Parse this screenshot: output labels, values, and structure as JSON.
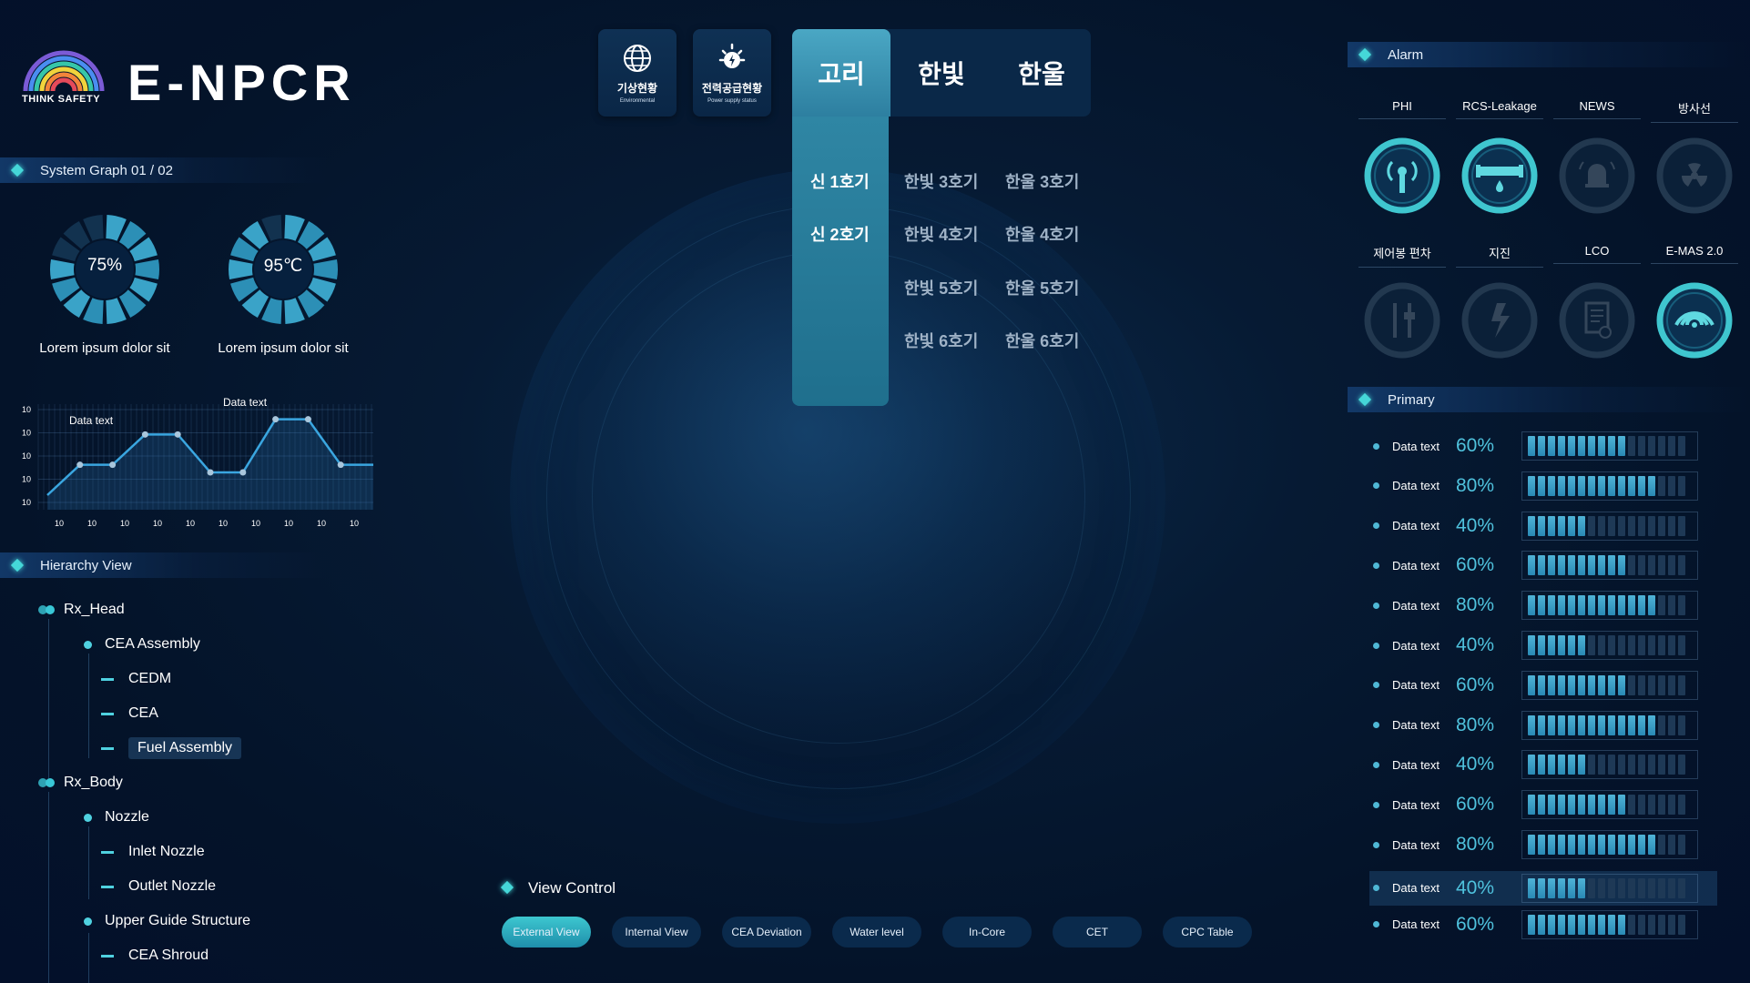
{
  "logo": {
    "title": "E-NPCR",
    "tagline": "THINK SAFETY"
  },
  "system_graph": {
    "title": "System Graph 01 / 02",
    "donuts": [
      {
        "value": "75%",
        "label": "Lorem ipsum dolor sit",
        "fraction": 0.75
      },
      {
        "value": "95℃",
        "label": "Lorem ipsum dolor sit",
        "fraction": 0.95
      }
    ]
  },
  "chart_data": {
    "type": "line",
    "annotations": [
      "Data text",
      "Data text"
    ],
    "ytick_labels": [
      "10",
      "10",
      "10",
      "10",
      "10"
    ],
    "xtick_labels": [
      "10",
      "10",
      "10",
      "10",
      "10",
      "10",
      "10",
      "10",
      "10",
      "10"
    ],
    "series": [
      {
        "values": [
          0,
          2,
          2,
          4,
          4,
          1.5,
          1.5,
          5,
          5,
          2,
          2
        ]
      }
    ],
    "ylim": [
      0,
      6
    ],
    "grid": true
  },
  "hierarchy": {
    "title": "Hierarchy View",
    "items": [
      {
        "label": "Rx_Head",
        "level": 0
      },
      {
        "label": "CEA Assembly",
        "level": 1
      },
      {
        "label": "CEDM",
        "level": 2
      },
      {
        "label": "CEA",
        "level": 2
      },
      {
        "label": "Fuel Assembly",
        "level": 2,
        "selected": true
      },
      {
        "label": "Rx_Body",
        "level": 0
      },
      {
        "label": "Nozzle",
        "level": 1
      },
      {
        "label": "Inlet Nozzle",
        "level": 2
      },
      {
        "label": "Outlet Nozzle",
        "level": 2
      },
      {
        "label": "Upper Guide Structure",
        "level": 1
      },
      {
        "label": "CEA Shroud",
        "level": 2
      }
    ]
  },
  "top_nav": {
    "weather": {
      "label": "기상현황",
      "sub": "Environmental",
      "icon": "globe-icon"
    },
    "power": {
      "label": "전력공급현황",
      "sub": "Power supply status",
      "icon": "power-icon"
    }
  },
  "sites": {
    "tabs": [
      "고리",
      "한빛",
      "한울"
    ],
    "active": "고리",
    "units": {
      "col1": [
        "신 1호기",
        "신 2호기"
      ],
      "col2": [
        "한빛 3호기",
        "한빛 4호기",
        "한빛 5호기",
        "한빛 6호기"
      ],
      "col3": [
        "한울 3호기",
        "한울 4호기",
        "한울 5호기",
        "한울 6호기"
      ]
    }
  },
  "view_control": {
    "title": "View Control",
    "buttons": [
      "External View",
      "Internal View",
      "CEA Deviation",
      "Water level",
      "In-Core",
      "CET",
      "CPC Table"
    ],
    "active": "External View"
  },
  "alarm": {
    "title": "Alarm",
    "row1": [
      {
        "label": "PHI",
        "icon": "signal-tower-icon",
        "active": true
      },
      {
        "label": "RCS-Leakage",
        "icon": "leak-icon",
        "active": true
      },
      {
        "label": "NEWS",
        "icon": "bell-icon",
        "active": false
      },
      {
        "label": "방사선",
        "icon": "radiation-icon",
        "active": false
      }
    ],
    "row2": [
      {
        "label": "제어봉 편차",
        "icon": "control-rod-icon",
        "active": false
      },
      {
        "label": "지진",
        "icon": "earthquake-icon",
        "active": false
      },
      {
        "label": "LCO",
        "icon": "document-icon",
        "active": false
      },
      {
        "label": "E-MAS 2.0",
        "icon": "wireless-icon",
        "active": true
      }
    ]
  },
  "primary": {
    "title": "Primary",
    "rows": [
      {
        "label": "Data text",
        "value": "60%",
        "fraction": 0.6
      },
      {
        "label": "Data text",
        "value": "80%",
        "fraction": 0.8
      },
      {
        "label": "Data text",
        "value": "40%",
        "fraction": 0.4
      },
      {
        "label": "Data text",
        "value": "60%",
        "fraction": 0.6
      },
      {
        "label": "Data text",
        "value": "80%",
        "fraction": 0.8
      },
      {
        "label": "Data text",
        "value": "40%",
        "fraction": 0.4
      },
      {
        "label": "Data text",
        "value": "60%",
        "fraction": 0.6
      },
      {
        "label": "Data text",
        "value": "80%",
        "fraction": 0.8
      },
      {
        "label": "Data text",
        "value": "40%",
        "fraction": 0.4
      },
      {
        "label": "Data text",
        "value": "60%",
        "fraction": 0.6
      },
      {
        "label": "Data text",
        "value": "80%",
        "fraction": 0.8
      },
      {
        "label": "Data text",
        "value": "40%",
        "fraction": 0.4,
        "highlighted": true
      },
      {
        "label": "Data text",
        "value": "60%",
        "fraction": 0.6
      }
    ]
  },
  "colors": {
    "accent": "#45d7d8",
    "bar": "#2a8ab5",
    "panel": "#0a2848"
  }
}
